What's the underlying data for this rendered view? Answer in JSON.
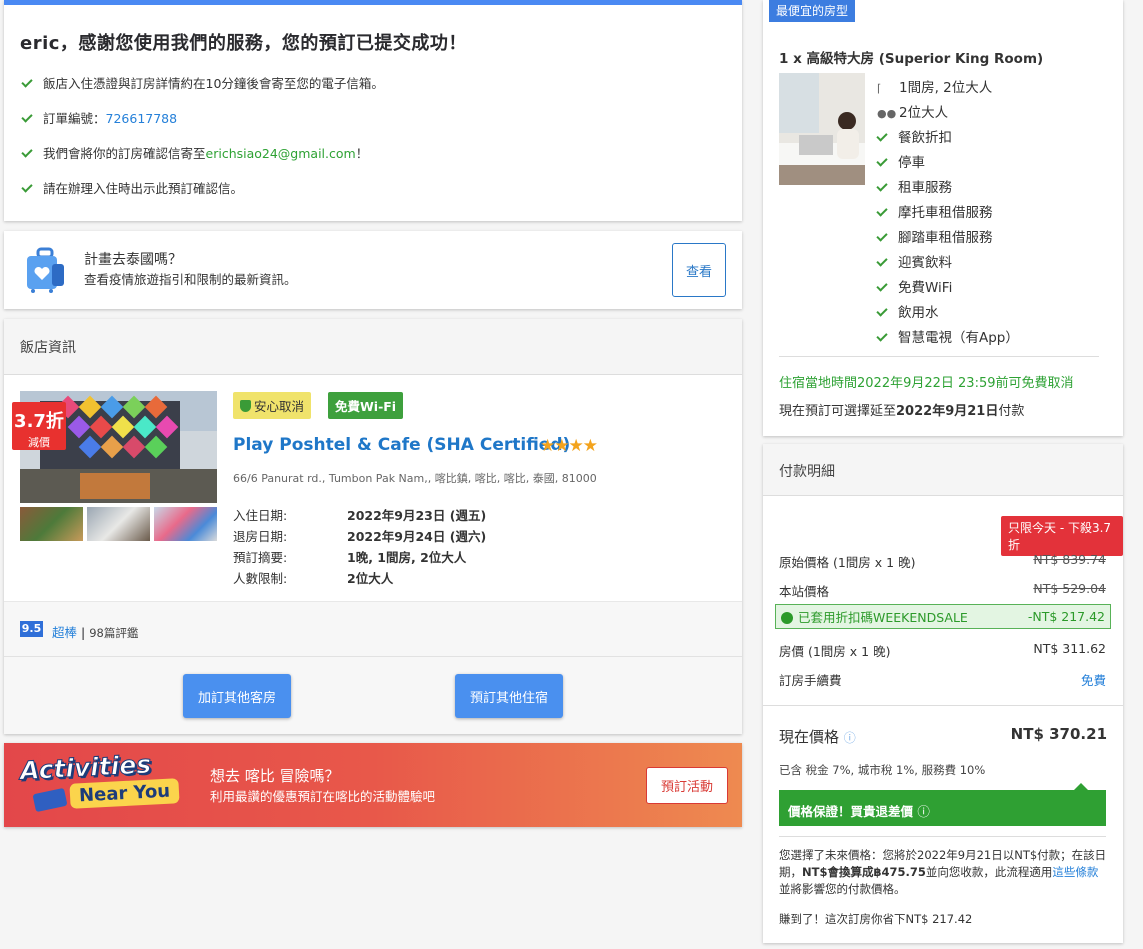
{
  "confirmation": {
    "title": "eric，感謝您使用我們的服務，您的預訂已提交成功！",
    "line1": "飯店入住憑證與訂房詳情約在10分鐘後會寄至您的電子信箱。",
    "order_label": "訂單編號：",
    "order_number": "726617788",
    "email_prefix": "我們會將你的訂房確認信寄至",
    "email": "erichsiao24@gmail.com",
    "email_suffix": "！",
    "line4": "請在辦理入住時出示此預訂確認信。"
  },
  "travel": {
    "title": "計畫去泰國嗎？",
    "subtitle": "查看疫情旅遊指引和限制的最新資訊。",
    "button": "查看"
  },
  "hotel": {
    "header": "飯店資訊",
    "discount": "3.7折",
    "discount_sub": "減價",
    "tag_safe": "安心取消",
    "tag_wifi": "免費Wi-Fi",
    "name": "Play Poshtel & Cafe (SHA Certified)",
    "stars": "★★★★",
    "address": "66/6 Panurat rd., Tumbon Pak Nam,, 喀比鎮, 喀比, 喀比, 泰國, 81000",
    "checkin_label": "入住日期:",
    "checkin": "2022年9月23日 (週五)",
    "checkout_label": "退房日期:",
    "checkout": "2022年9月24日 (週六)",
    "summary_label": "預訂摘要:",
    "summary": "1晚, 1間房, 2位大人",
    "limit_label": "人數限制:",
    "limit": "2位大人",
    "score": "9.5",
    "rating": "超棒",
    "reviews": "98篇評鑑",
    "btn_rooms": "加訂其他客房",
    "btn_stay": "預訂其他住宿"
  },
  "activities": {
    "logo1": "Activities",
    "logo2": "Near You",
    "title": "想去 喀比 冒險嗎？",
    "subtitle": "利用最讚的優惠預訂在喀比的活動體驗吧",
    "button": "預訂活動"
  },
  "room": {
    "badge": "最便宜的房型",
    "name": "1 x 高級特大房 (Superior King Room)",
    "amenities": [
      "1間房, 2位大人",
      "2位大人",
      "餐飲折扣",
      "停車",
      "租車服務",
      "摩托車租借服務",
      "腳踏車租借服務",
      "迎賓飲料",
      "免費WiFi",
      "飲用水",
      "智慧電視（有App）"
    ],
    "cancel": "住宿當地時間2022年9月22日 23:59前可免費取消",
    "pay_prefix": "現在預訂可選擇延至",
    "pay_date": "2022年9月21日",
    "pay_suffix": "付款"
  },
  "payment": {
    "header": "付款明細",
    "limited": "只限今天 - 下殺3.7折",
    "orig_label": "原始價格 (1間房 x 1 晚)",
    "orig": "NT$ 839.74",
    "site_label": "本站價格",
    "site": "NT$ 529.04",
    "coupon_label": "已套用折扣碼WEEKENDSALE",
    "coupon": "-NT$ 217.42",
    "room_label": "房價 (1間房 x 1 晚)",
    "room": "NT$ 311.62",
    "fee_label": "訂房手續費",
    "fee": "免費",
    "now_label": "現在價格",
    "now": "NT$ 370.21",
    "tax": "已含 稅金 7%, 城市稅 1%, 服務費 10%",
    "guarantee": "價格保證！買貴退差價",
    "future_1": "您選擇了未來價格：您將於2022年9月21日以NT$付款；在該日期，",
    "future_bold": "NT$會換算成฿475.75",
    "future_2": "並向您收款，此流程適用",
    "future_link": "這些條款",
    "future_3": "並將影響您的付款價格。",
    "saved": "賺到了！這次訂房你省下NT$ 217.42"
  }
}
